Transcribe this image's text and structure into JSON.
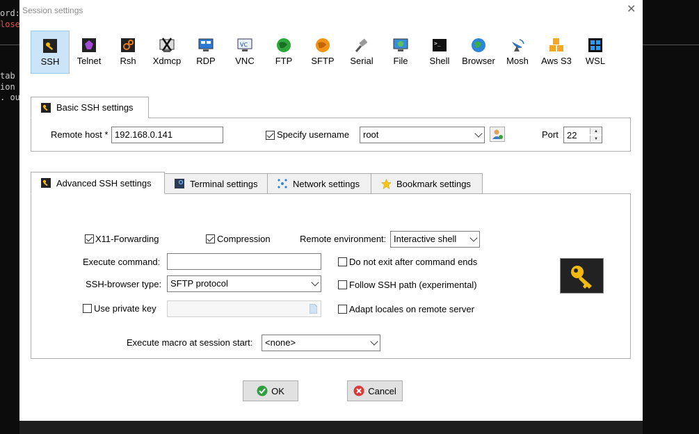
{
  "terminal": {
    "lines": [
      "ord:",
      "lose",
      "tab",
      "ion",
      ". ou"
    ]
  },
  "dialog": {
    "title": "Session settings",
    "close_glyph": "✕"
  },
  "toolbar": [
    {
      "label": "SSH",
      "icon": "ssh-key-icon",
      "selected": true
    },
    {
      "label": "Telnet",
      "icon": "telnet-icon"
    },
    {
      "label": "Rsh",
      "icon": "rsh-icon"
    },
    {
      "label": "Xdmcp",
      "icon": "xdmcp-icon"
    },
    {
      "label": "RDP",
      "icon": "rdp-monitor-icon"
    },
    {
      "label": "VNC",
      "icon": "vnc-icon"
    },
    {
      "label": "FTP",
      "icon": "ftp-globe-icon"
    },
    {
      "label": "SFTP",
      "icon": "sftp-globe-icon"
    },
    {
      "label": "Serial",
      "icon": "serial-plug-icon"
    },
    {
      "label": "File",
      "icon": "file-monitor-icon"
    },
    {
      "label": "Shell",
      "icon": "shell-terminal-icon"
    },
    {
      "label": "Browser",
      "icon": "browser-globe-icon"
    },
    {
      "label": "Mosh",
      "icon": "mosh-satellite-icon"
    },
    {
      "label": "Aws S3",
      "icon": "aws-s3-cubes-icon"
    },
    {
      "label": "WSL",
      "icon": "windows-logo-icon"
    }
  ],
  "basic": {
    "tab_label": "Basic SSH settings",
    "remote_host_label": "Remote host *",
    "remote_host_value": "192.168.0.141",
    "specify_username_label": "Specify username",
    "specify_username_checked": true,
    "username_value": "root",
    "port_label": "Port",
    "port_value": "22"
  },
  "tabs": [
    {
      "label": "Advanced SSH settings",
      "active": true
    },
    {
      "label": "Terminal settings"
    },
    {
      "label": "Network settings"
    },
    {
      "label": "Bookmark settings"
    }
  ],
  "advanced": {
    "x11_label": "X11-Forwarding",
    "x11_checked": true,
    "compression_label": "Compression",
    "compression_checked": true,
    "remote_env_label": "Remote environment:",
    "remote_env_value": "Interactive shell",
    "exec_cmd_label": "Execute command:",
    "exec_cmd_value": "",
    "no_exit_label": "Do not exit after command ends",
    "browser_type_label": "SSH-browser type:",
    "browser_type_value": "SFTP protocol",
    "follow_path_label": "Follow SSH path (experimental)",
    "private_key_label": "Use private key",
    "adapt_locales_label": "Adapt locales on remote server",
    "macro_label": "Execute macro at session start:",
    "macro_value": "<none>"
  },
  "buttons": {
    "ok_label": "OK",
    "cancel_label": "Cancel"
  },
  "colors": {
    "selected_bg": "#cce4f7",
    "ok_green": "#2e9e3e",
    "cancel_red": "#d93b3b",
    "key_gold": "#f2b90f"
  }
}
